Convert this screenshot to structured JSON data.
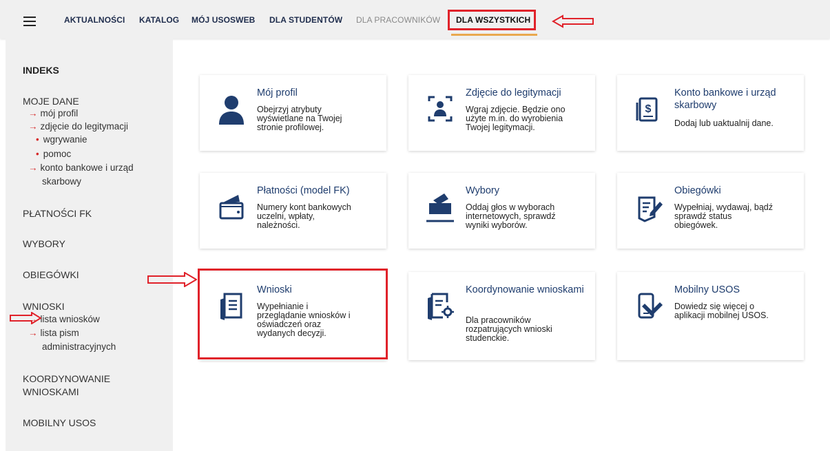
{
  "nav": {
    "items": [
      "AKTUALNOŚCI",
      "KATALOG",
      "MÓJ USOSWEB",
      "DLA STUDENTÓW",
      "DLA PRACOWNIKÓW",
      "DLA WSZYSTKICH"
    ]
  },
  "sidebar": {
    "indeks": "INDEKS",
    "moje_dane": "MOJE DANE",
    "moj_profil": "mój profil",
    "zdjecie": "zdjęcie do legitymacji",
    "wgrywanie": "wgrywanie",
    "pomoc": "pomoc",
    "konto_1": "konto bankowe i urząd",
    "konto_2": "skarbowy",
    "platnosci": "PŁATNOŚCI FK",
    "wybory": "WYBORY",
    "obiegowki": "OBIEGÓWKI",
    "wnioski": "WNIOSKI",
    "lista_wnioskow": "lista wniosków",
    "lista_pism_1": "lista pism",
    "lista_pism_2": "administracyjnych",
    "koordynowanie_1": "KOORDYNOWANIE",
    "koordynowanie_2": "WNIOSKAMI",
    "mobilny": "MOBILNY USOS"
  },
  "cards": [
    {
      "title": "Mój profil",
      "desc": [
        "Obejrzyj atrybuty",
        "wyświetlane na Twojej",
        "stronie profilowej."
      ],
      "icon": "user-icon"
    },
    {
      "title": "Zdjęcie do legitymacji",
      "desc": [
        "Wgraj zdjęcie. Będzie ono",
        "użyte m.in. do wyrobienia",
        "Twojej legitymacji."
      ],
      "icon": "photo-id-icon"
    },
    {
      "title": "Konto bankowe i urząd skarbowy",
      "desc": [
        "Dodaj lub uaktualnij dane."
      ],
      "icon": "bank-document-icon"
    },
    {
      "title": "Płatności (model FK)",
      "desc": [
        "Numery kont bankowych",
        "uczelni, wpłaty,",
        "należności."
      ],
      "icon": "wallet-icon"
    },
    {
      "title": "Wybory",
      "desc": [
        "Oddaj głos w wyborach",
        "internetowych, sprawdź",
        "wyniki wyborów."
      ],
      "icon": "ballot-box-icon"
    },
    {
      "title": "Obiegówki",
      "desc": [
        "Wypełniaj, wydawaj, bądź",
        "sprawdź status",
        "obiegówek."
      ],
      "icon": "form-edit-icon"
    },
    {
      "title": "Wnioski",
      "desc": [
        "Wypełnianie i",
        "przeglądanie wniosków i",
        "oświadczeń oraz",
        "wydanych decyzji."
      ],
      "icon": "document-icon"
    },
    {
      "title": "Koordynowanie wnioskami",
      "desc": [
        "Dla pracowników",
        "rozpatrujących wnioski",
        "studenckie."
      ],
      "icon": "document-gear-icon"
    },
    {
      "title": "Mobilny USOS",
      "desc": [
        "Dowiedz się więcej o",
        "aplikacji mobilnej USOS."
      ],
      "icon": "mobile-icon"
    }
  ],
  "colors": {
    "accent": "#1f3d6e",
    "highlight": "#e0222a",
    "underline": "#e9a84f"
  }
}
